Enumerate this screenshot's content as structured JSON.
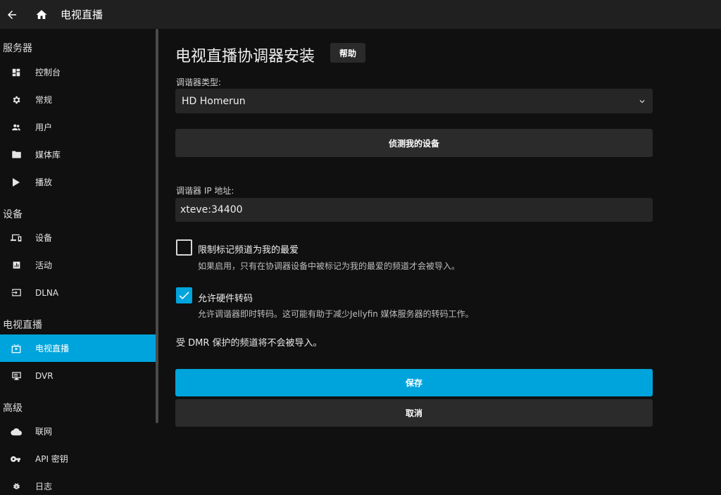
{
  "header": {
    "title": "电视直播"
  },
  "sidebar": {
    "sections": {
      "server": "服务器",
      "devices": "设备",
      "livetv": "电视直播",
      "advanced": "高级"
    },
    "items": {
      "dashboard": "控制台",
      "general": "常规",
      "users": "用户",
      "libraries": "媒体库",
      "playback": "播放",
      "devices": "设备",
      "activity": "活动",
      "dlna": "DLNA",
      "livetv": "电视直播",
      "dvr": "DVR",
      "networking": "联网",
      "apikeys": "API 密钥",
      "logs": "日志"
    },
    "active_item": "livetv"
  },
  "page": {
    "title": "电视直播协调器安装",
    "help_label": "帮助",
    "tuner_type_label": "调谐器类型:",
    "tuner_type_value": "HD Homerun",
    "detect_button": "侦测我的设备",
    "ip_label": "调谐器 IP 地址:",
    "ip_value": "xteve:34400",
    "favorites_checkbox": {
      "label": "限制标记频道为我的最爱",
      "description": "如果启用，只有在协调器设备中被标记为我的最爱的频道才会被导入。",
      "checked": false
    },
    "hw_transcode_checkbox": {
      "label": "允许硬件转码",
      "description": "允许调谐器即时转码。这可能有助于减少Jellyfin 媒体服务器的转码工作。",
      "checked": true
    },
    "drm_note": "受 DMR 保护的频道将不会被导入。",
    "save_label": "保存",
    "cancel_label": "取消"
  },
  "colors": {
    "accent": "#00a4dc",
    "background": "#101010",
    "header": "#202020",
    "field": "#262626"
  }
}
